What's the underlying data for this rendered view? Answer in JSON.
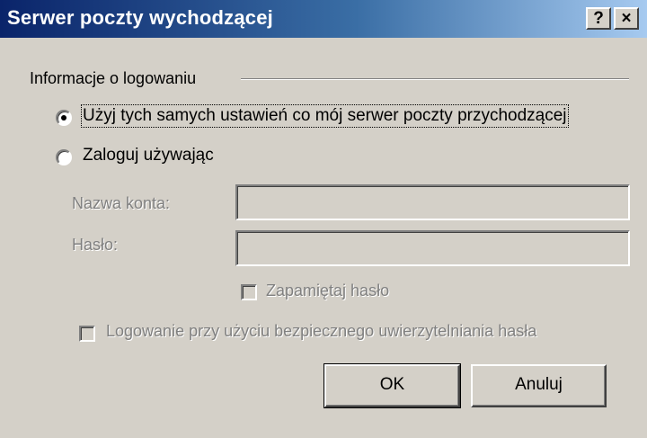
{
  "window": {
    "title": "Serwer poczty wychodzącej",
    "help_button": "?",
    "close_button": "×"
  },
  "group": {
    "label": "Informacje o logowaniu"
  },
  "options": {
    "same_settings": "Użyj tych samych ustawień co mój serwer poczty przychodzącej",
    "login_using": "Zaloguj używając",
    "selected": "same_settings"
  },
  "fields": {
    "account_label": "Nazwa konta:",
    "account_value": "",
    "password_label": "Hasło:",
    "password_value": ""
  },
  "checkboxes": {
    "remember_password": "Zapamiętaj hasło",
    "secure_password_auth": "Logowanie przy użyciu bezpiecznego uwierzytelniania hasła"
  },
  "buttons": {
    "ok": "OK",
    "cancel": "Anuluj"
  }
}
